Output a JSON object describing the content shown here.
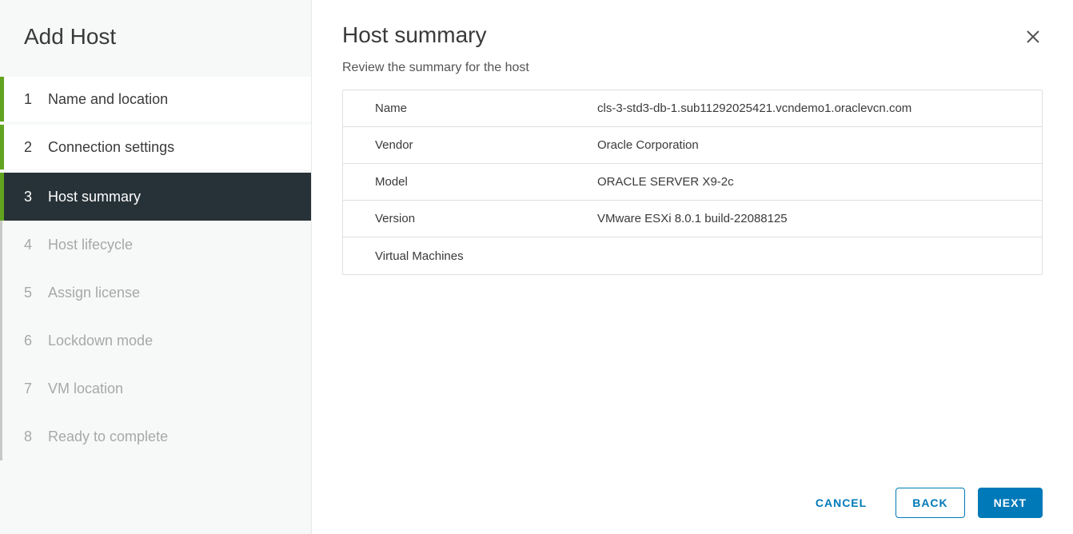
{
  "wizard": {
    "title": "Add Host",
    "steps": [
      {
        "num": "1",
        "label": "Name and location",
        "state": "completed"
      },
      {
        "num": "2",
        "label": "Connection settings",
        "state": "completed"
      },
      {
        "num": "3",
        "label": "Host summary",
        "state": "active"
      },
      {
        "num": "4",
        "label": "Host lifecycle",
        "state": "pending"
      },
      {
        "num": "5",
        "label": "Assign license",
        "state": "pending"
      },
      {
        "num": "6",
        "label": "Lockdown mode",
        "state": "pending"
      },
      {
        "num": "7",
        "label": "VM location",
        "state": "pending"
      },
      {
        "num": "8",
        "label": "Ready to complete",
        "state": "pending"
      }
    ]
  },
  "main": {
    "title": "Host summary",
    "subtitle": "Review the summary for the host",
    "rows": [
      {
        "label": "Name",
        "value": "cls-3-std3-db-1.sub11292025421.vcndemo1.oraclevcn.com"
      },
      {
        "label": "Vendor",
        "value": "Oracle Corporation"
      },
      {
        "label": "Model",
        "value": "ORACLE SERVER X9-2c"
      },
      {
        "label": "Version",
        "value": "VMware ESXi 8.0.1 build-22088125"
      },
      {
        "label": "Virtual Machines",
        "value": ""
      }
    ]
  },
  "footer": {
    "cancel": "CANCEL",
    "back": "BACK",
    "next": "NEXT"
  }
}
